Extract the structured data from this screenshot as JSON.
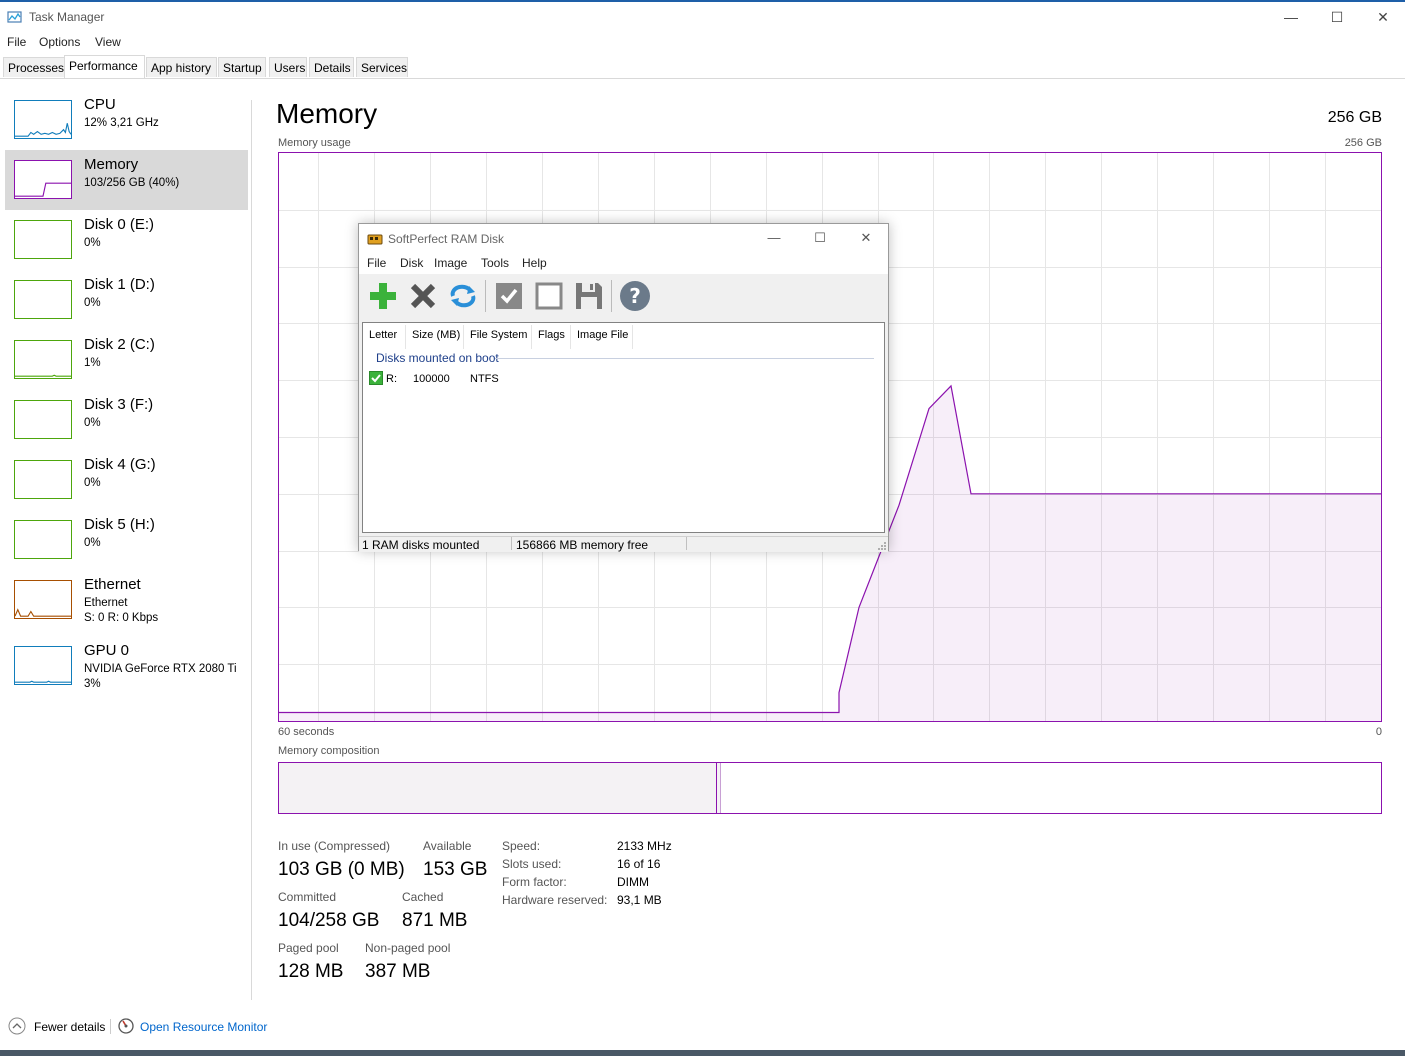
{
  "window": {
    "title": "Task Manager",
    "minimize": "—",
    "maximize": "☐",
    "close": "✕"
  },
  "menu": [
    "File",
    "Options",
    "View"
  ],
  "tabs": [
    "Processes",
    "Performance",
    "App history",
    "Startup",
    "Users",
    "Details",
    "Services"
  ],
  "active_tab": "Performance",
  "sidebar": {
    "items": [
      {
        "name": "CPU",
        "sub": "12% 3,21 GHz",
        "sub2": "",
        "color": "#117dbb"
      },
      {
        "name": "Memory",
        "sub": "103/256 GB (40%)",
        "sub2": "",
        "color": "#8b12ae"
      },
      {
        "name": "Disk 0 (E:)",
        "sub": "0%",
        "sub2": "",
        "color": "#4da60c"
      },
      {
        "name": "Disk 1 (D:)",
        "sub": "0%",
        "sub2": "",
        "color": "#4da60c"
      },
      {
        "name": "Disk 2 (C:)",
        "sub": "1%",
        "sub2": "",
        "color": "#4da60c"
      },
      {
        "name": "Disk 3 (F:)",
        "sub": "0%",
        "sub2": "",
        "color": "#4da60c"
      },
      {
        "name": "Disk 4 (G:)",
        "sub": "0%",
        "sub2": "",
        "color": "#4da60c"
      },
      {
        "name": "Disk 5 (H:)",
        "sub": "0%",
        "sub2": "",
        "color": "#4da60c"
      },
      {
        "name": "Ethernet",
        "sub": "Ethernet",
        "sub2": "S: 0 R: 0 Kbps",
        "color": "#a74f01"
      },
      {
        "name": "GPU 0",
        "sub": "NVIDIA GeForce RTX 2080 Ti",
        "sub2": "3%",
        "color": "#117dbb"
      }
    ]
  },
  "main": {
    "title": "Memory",
    "total": "256 GB",
    "usage_label": "Memory usage",
    "usage_max": "256 GB",
    "time_left": "60 seconds",
    "time_right": "0",
    "composition_label": "Memory composition",
    "memory_usage_fraction_series": [
      0.015,
      0.015,
      0.015,
      0.015,
      0.015,
      0.015,
      0.015,
      0.015,
      0.015,
      0.015,
      0.015,
      0.015,
      0.015,
      0.015,
      0.015,
      0.015,
      0.015,
      0.015,
      0.015,
      0.015,
      0.015,
      0.015,
      0.015,
      0.015,
      0.015,
      0.015,
      0.015,
      0.015,
      0.015,
      0.015,
      0.015,
      0.05,
      0.2,
      0.38,
      0.55,
      0.59,
      0.4,
      0.4
    ],
    "in_use_fraction": 0.4
  },
  "stats": {
    "in_use_label": "In use (Compressed)",
    "in_use_value": "103 GB (0 MB)",
    "available_label": "Available",
    "available_value": "153 GB",
    "committed_label": "Committed",
    "committed_value": "104/258 GB",
    "cached_label": "Cached",
    "cached_value": "871 MB",
    "paged_label": "Paged pool",
    "paged_value": "128 MB",
    "nonpaged_label": "Non-paged pool",
    "nonpaged_value": "387 MB"
  },
  "hardware": {
    "speed_label": "Speed:",
    "speed_value": "2133 MHz",
    "slots_label": "Slots used:",
    "slots_value": "16 of 16",
    "form_label": "Form factor:",
    "form_value": "DIMM",
    "reserved_label": "Hardware reserved:",
    "reserved_value": "93,1 MB"
  },
  "footer": {
    "fewer_details": "Fewer details",
    "resource_monitor": "Open Resource Monitor",
    "link_color": "#0066cc"
  },
  "ramdisk": {
    "title": "SoftPerfect RAM Disk",
    "menu": [
      "File",
      "Disk",
      "Image",
      "Tools",
      "Help"
    ],
    "columns": [
      "Letter",
      "Size (MB)",
      "File System",
      "Flags",
      "Image File"
    ],
    "group": "Disks mounted on boot",
    "row": {
      "letter": "R:",
      "size": "100000",
      "fs": "NTFS"
    },
    "status_left": "1 RAM disks mounted",
    "status_right": "156866 MB memory free"
  }
}
